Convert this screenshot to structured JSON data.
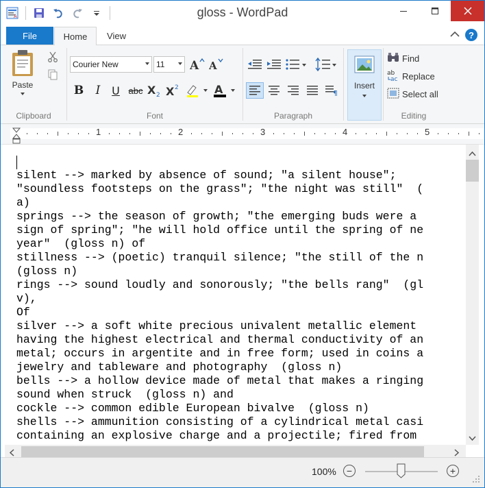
{
  "window": {
    "title": "gloss - WordPad"
  },
  "tabs": {
    "file": "File",
    "home": "Home",
    "view": "View"
  },
  "clipboard": {
    "paste_label": "Paste",
    "group_label": "Clipboard"
  },
  "font": {
    "family": "Courier New",
    "size": "11",
    "group_label": "Font"
  },
  "paragraph": {
    "group_label": "Paragraph"
  },
  "insert": {
    "label": "Insert"
  },
  "editing": {
    "find": "Find",
    "replace": "Replace",
    "select_all": "Select all",
    "group_label": "Editing"
  },
  "ruler": {
    "numbers": [
      "1",
      "2",
      "3",
      "4",
      "5"
    ]
  },
  "document": {
    "lines": [
      "silent --> marked by absence of sound; \"a silent house\";",
      "\"soundless footsteps on the grass\"; \"the night was still\"  (",
      "a)",
      "springs --> the season of growth; \"the emerging buds were a",
      "sign of spring\"; \"he will hold office until the spring of ne",
      "year\"  (gloss n) of",
      "stillness --> (poetic) tranquil silence; \"the still of the n",
      "(gloss n)",
      "rings --> sound loudly and sonorously; \"the bells rang\"  (gl",
      "v),",
      "Of",
      "silver --> a soft white precious univalent metallic element",
      "having the highest electrical and thermal conductivity of an",
      "metal; occurs in argentite and in free form; used in coins a",
      "jewelry and tableware and photography  (gloss n)",
      "bells --> a hollow device made of metal that makes a ringing",
      "sound when struck  (gloss n) and",
      "cockle --> common edible European bivalve  (gloss n)",
      "shells --> ammunition consisting of a cylindrical metal casi",
      "containing an explosive charge and a projectile; fired from"
    ]
  },
  "status": {
    "zoom": "100%"
  },
  "colors": {
    "accent": "#1979ca",
    "close": "#c7302b",
    "ribbon_bg": "#f5f6f7"
  }
}
